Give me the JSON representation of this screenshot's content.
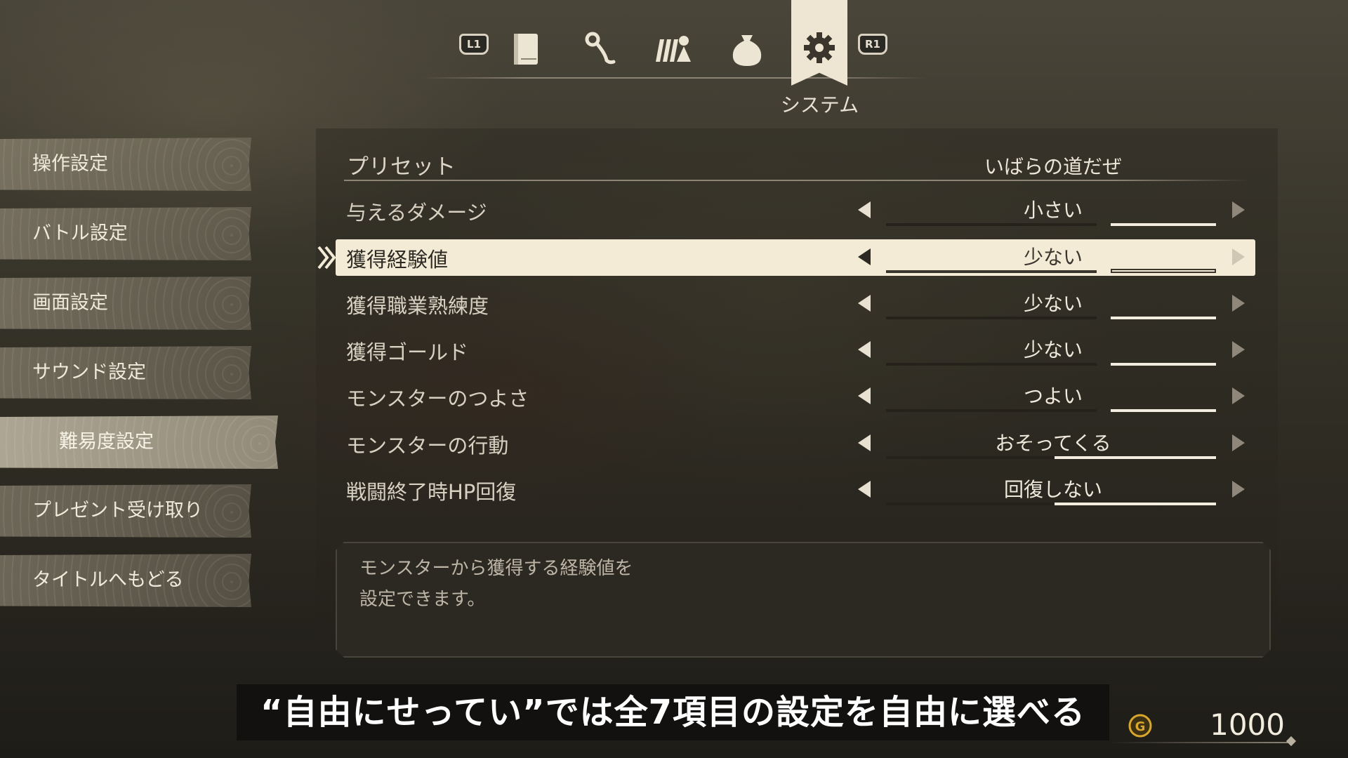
{
  "tabs": {
    "left_shoulder": "L1",
    "right_shoulder": "R1",
    "icons": [
      "book-icon",
      "key-icon",
      "party-icon",
      "pouch-icon",
      "gear-icon"
    ],
    "active_label": "システム"
  },
  "menu": [
    {
      "label": "操作設定"
    },
    {
      "label": "バトル設定"
    },
    {
      "label": "画面設定"
    },
    {
      "label": "サウンド設定"
    },
    {
      "label": "難易度設定",
      "selected": true
    },
    {
      "label": "プレゼント受け取り"
    },
    {
      "label": "タイトルへもどる"
    }
  ],
  "preset": {
    "label": "プリセット",
    "value": "いばらの道だぜ"
  },
  "settings": [
    {
      "label": "与えるダメージ",
      "value": "小さい",
      "level": 1
    },
    {
      "label": "獲得経験値",
      "value": "少ない",
      "level": 1,
      "selected": true
    },
    {
      "label": "獲得職業熟練度",
      "value": "少ない",
      "level": 1
    },
    {
      "label": "獲得ゴールド",
      "value": "少ない",
      "level": 1
    },
    {
      "label": "モンスターのつよさ",
      "value": "つよい",
      "level": 1
    },
    {
      "label": "モンスターの行動",
      "value": "おそってくる",
      "level": 0
    },
    {
      "label": "戦闘終了時HP回復",
      "value": "回復しない",
      "level": 0
    }
  ],
  "description": {
    "line1": "モンスターから獲得する経験値を",
    "line2": "設定できます。"
  },
  "subtitle": "“自由にせってい”では全7項目の設定を自由に選べる",
  "gold": {
    "value": "1000",
    "icon": "gold-coin-icon",
    "color": "#d9a72c"
  }
}
